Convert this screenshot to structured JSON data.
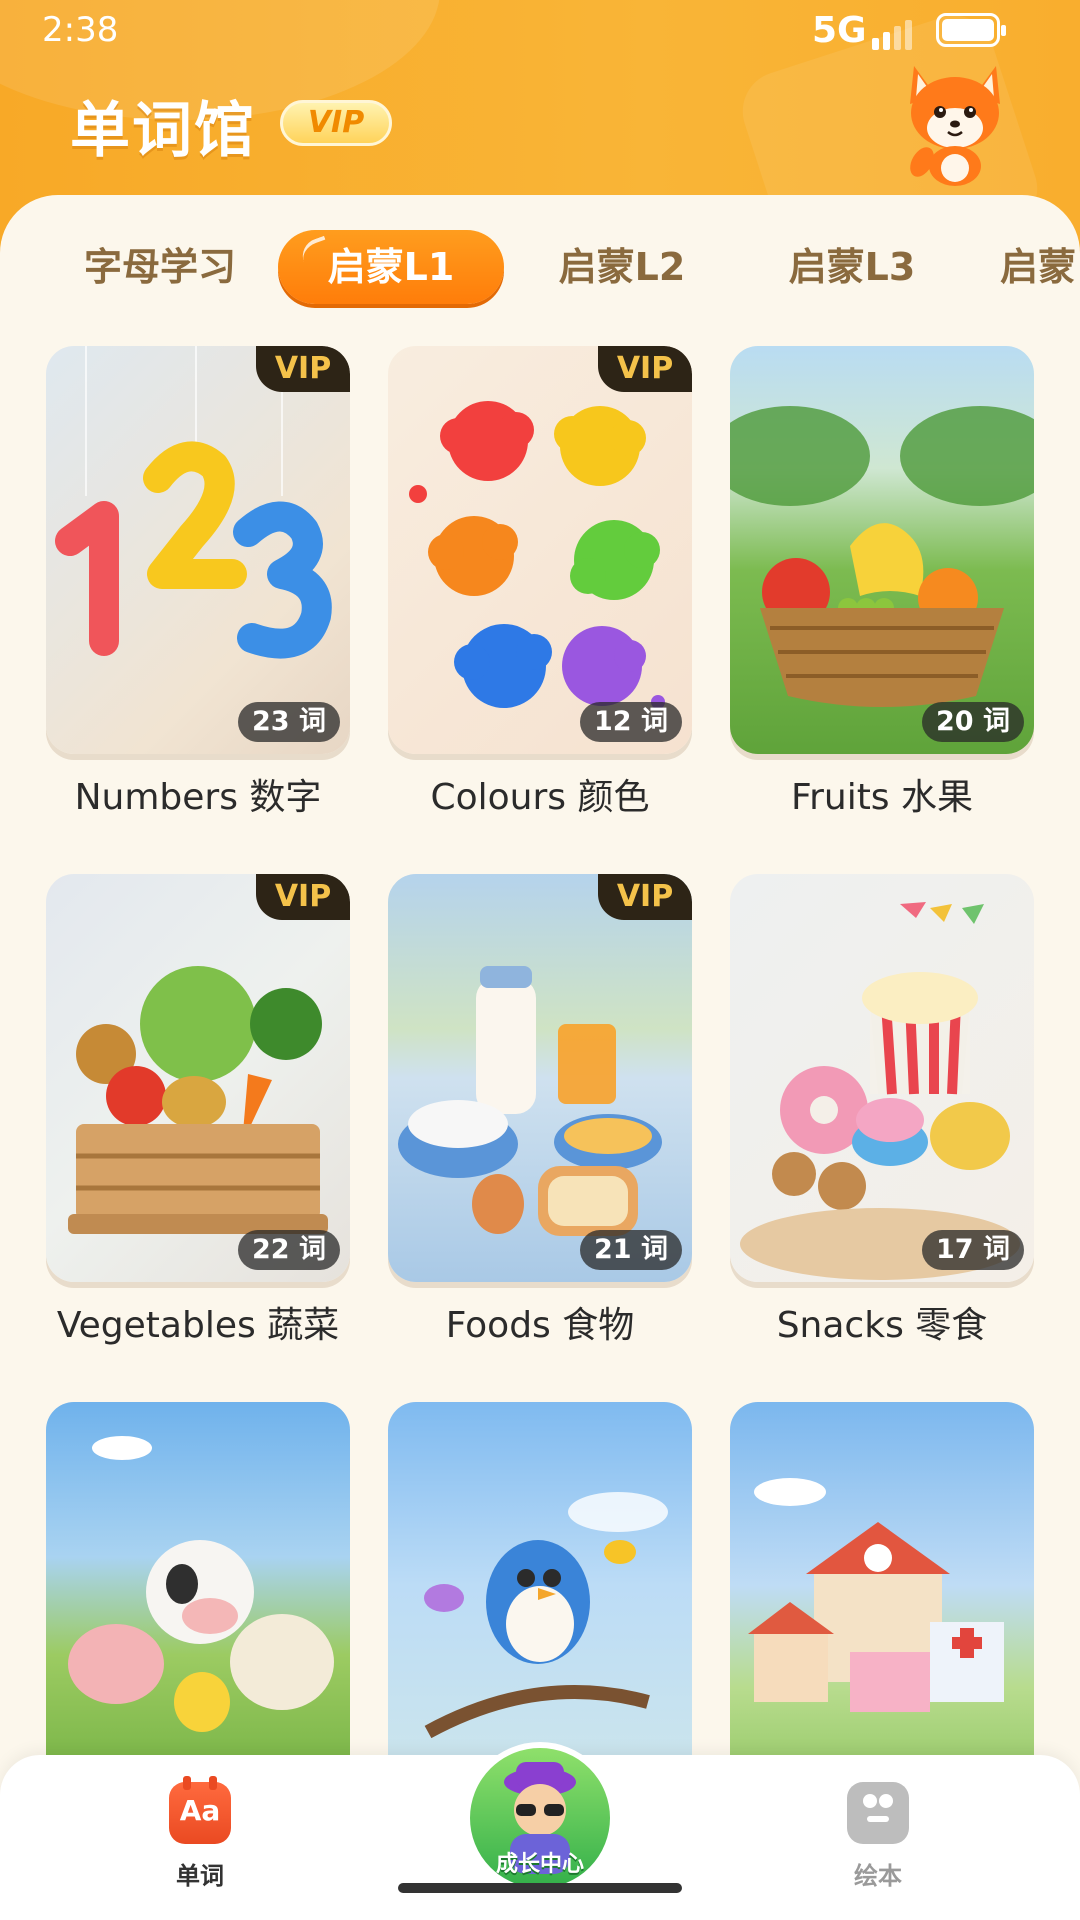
{
  "status_bar": {
    "time": "2:38",
    "network": "5G"
  },
  "header": {
    "title": "单词馆",
    "vip_badge": "VIP"
  },
  "tabs": [
    {
      "label": "字母学习",
      "active": false
    },
    {
      "label": "启蒙L1",
      "active": true
    },
    {
      "label": "启蒙L2",
      "active": false
    },
    {
      "label": "启蒙L3",
      "active": false
    },
    {
      "label": "启蒙",
      "active": false
    }
  ],
  "cards": [
    {
      "label": "Numbers 数字",
      "count": "23 词",
      "vip": "VIP"
    },
    {
      "label": "Colours 颜色",
      "count": "12 词",
      "vip": "VIP"
    },
    {
      "label": "Fruits 水果",
      "count": "20 词",
      "vip": ""
    },
    {
      "label": "Vegetables 蔬菜",
      "count": "22 词",
      "vip": "VIP"
    },
    {
      "label": "Foods 食物",
      "count": "21 词",
      "vip": "VIP"
    },
    {
      "label": "Snacks 零食",
      "count": "17 词",
      "vip": ""
    },
    {
      "label": "",
      "count": "",
      "vip": ""
    },
    {
      "label": "",
      "count": "",
      "vip": ""
    },
    {
      "label": "",
      "count": "",
      "vip": ""
    }
  ],
  "bottom_nav": {
    "words_label": "单词",
    "words_icon_text": "Aa",
    "center_label": "成长中心",
    "books_label": "绘本"
  },
  "colors": {
    "accent": "#ff8a12",
    "header": "#f9b030",
    "vip_text": "#f4c24a",
    "active_nav": "#e84c2a"
  }
}
